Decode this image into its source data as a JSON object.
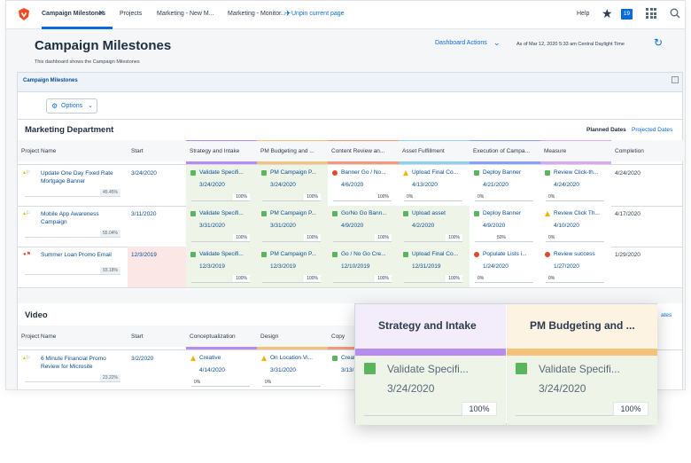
{
  "topbar": {
    "tabs": [
      "Campaign Milestones",
      "Projects",
      "Marketing - New M...",
      "Marketing - Monitor..."
    ],
    "unpin_label": "Unpin current page",
    "help_label": "Help",
    "notification_count": "19"
  },
  "header": {
    "title": "Campaign Milestones",
    "subtitle": "This dashboard shows the Campaign Milestones",
    "dashboard_actions_label": "Dashboard Actions",
    "as_of": "As of  Mar 12, 2020 5:33 am Central Daylight Time"
  },
  "panel": {
    "title": "Campaign Milestones",
    "options_label": "Options",
    "planned_dates_label": "Planned Dates",
    "projected_dates_label": "Projected Dates",
    "projected_dates_label_short": "ates"
  },
  "marketing": {
    "title": "Marketing Department",
    "columns": [
      "Project Name",
      "Start",
      "Strategy and Intake",
      "PM Budgeting and ...",
      "Content Review an...",
      "Asset Fulfillment",
      "Execution of Campa...",
      "Measure",
      "Completion"
    ],
    "column_colors": [
      "",
      "",
      "#b58cf0",
      "#f5c27a",
      "#f29a7a",
      "#8fd0f0",
      "#8aa0f0",
      "#d8a8f5",
      ""
    ],
    "rows": [
      {
        "name": "Update One Day Fixed Rate Mortgage Banner",
        "percent": "45.45%",
        "start": "3/24/2020",
        "completion": "4/24/2020",
        "milestones": [
          {
            "status": "complete",
            "name": "Validate Specifi...",
            "date": "3/24/2020",
            "progress": "100%"
          },
          {
            "status": "complete",
            "name": "PM Campaign P...",
            "date": "3/24/2020",
            "progress": "100%"
          },
          {
            "status": "late",
            "name": "Banner Go / No...",
            "date": "4/6/2020",
            "progress": "100%"
          },
          {
            "status": "warning",
            "name": "Upload Final Co...",
            "date": "4/13/2020",
            "progress": "0%"
          },
          {
            "status": "complete",
            "name": "Deploy Banner",
            "date": "4/21/2020",
            "progress": "0%"
          },
          {
            "status": "complete",
            "name": "Review Click-th...",
            "date": "4/24/2020",
            "progress": "0%"
          }
        ]
      },
      {
        "name": "Mobile App Awareness Campaign",
        "percent": "55.04%",
        "start": "3/11/2020",
        "completion": "4/17/2020",
        "milestones": [
          {
            "status": "complete",
            "name": "Validate Specifi...",
            "date": "3/31/2020",
            "progress": "100%"
          },
          {
            "status": "complete",
            "name": "PM Campaign P...",
            "date": "3/31/2020",
            "progress": "100%"
          },
          {
            "status": "complete",
            "name": "Go/No Go Bann...",
            "date": "4/9/2020",
            "progress": "100%"
          },
          {
            "status": "complete",
            "name": "Upload asset",
            "date": "4/2/2020",
            "progress": "100%"
          },
          {
            "status": "complete",
            "name": "Deploy Banner",
            "date": "4/9/2020",
            "progress": "50%"
          },
          {
            "status": "warning",
            "name": "Review Click Th...",
            "date": "4/10/2020",
            "progress": "0%"
          }
        ]
      },
      {
        "name": "Summer Loan Promo Email",
        "percent": "93.18%",
        "start": "12/3/2019",
        "completion": "1/29/2020",
        "milestones": [
          {
            "status": "complete",
            "name": "Validate Specifi...",
            "date": "12/3/2019",
            "progress": "100%"
          },
          {
            "status": "complete",
            "name": "PM Campaign P...",
            "date": "12/3/2019",
            "progress": "100%"
          },
          {
            "status": "complete",
            "name": "Go / No Go Cre...",
            "date": "12/10/2019",
            "progress": "100%"
          },
          {
            "status": "complete",
            "name": "Upload Final Co...",
            "date": "12/31/2019",
            "progress": "100%"
          },
          {
            "status": "late",
            "name": "Populate Lists i...",
            "date": "1/24/2020",
            "progress": "0%"
          },
          {
            "status": "late",
            "name": "Review success",
            "date": "1/27/2020",
            "progress": "0%"
          }
        ]
      }
    ]
  },
  "video": {
    "title": "Video",
    "columns": [
      "Project Name",
      "Start",
      "Conceptualization",
      "Design",
      "Copy"
    ],
    "row": {
      "name": "6 Minute Financial Promo Review for Microsite",
      "percent": "23.22%",
      "start": "3/2/2020",
      "milestones": [
        {
          "status": "warning",
          "name": "Creative",
          "date": "4/14/2020",
          "progress": "0%"
        },
        {
          "status": "warning",
          "name": "On Location Vi...",
          "date": "3/31/2020",
          "progress": "0%"
        },
        {
          "status": "complete",
          "name": "Create",
          "date": "3/13/"
        }
      ]
    }
  },
  "zoom": {
    "columns": [
      {
        "header": "Strategy and Intake",
        "color": "#b58cf0",
        "head_bg": "#f3ecfb",
        "name": "Validate Specifi...",
        "date": "3/24/2020",
        "progress": "100%"
      },
      {
        "header": "PM Budgeting and ...",
        "color": "#f5c27a",
        "head_bg": "#fdf3e3",
        "name": "Validate Specifi...",
        "date": "3/24/2020",
        "progress": "100%"
      }
    ]
  }
}
